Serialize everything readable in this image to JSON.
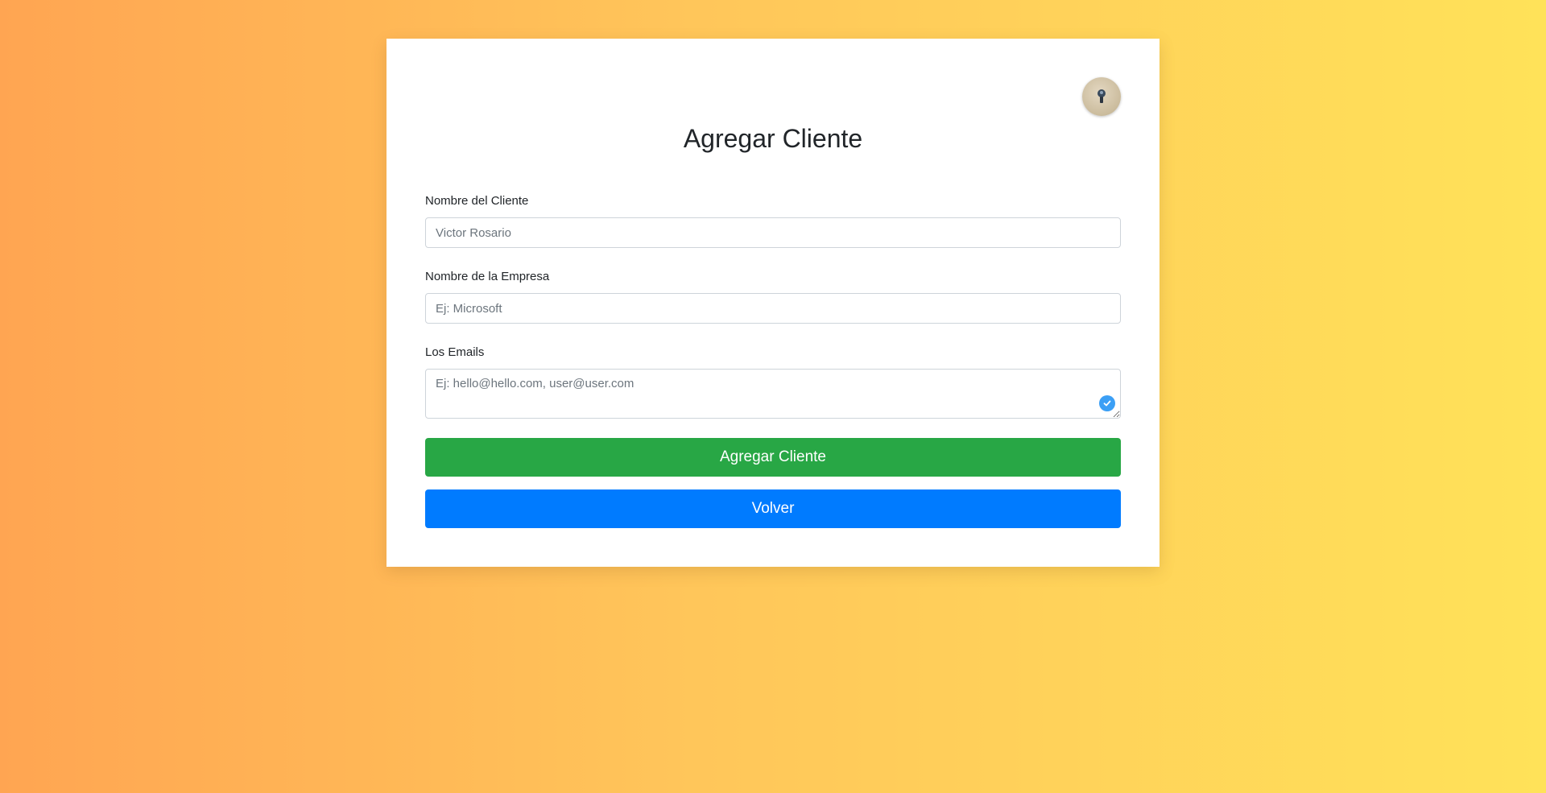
{
  "form": {
    "title": "Agregar Cliente",
    "client_name": {
      "label": "Nombre del Cliente",
      "placeholder": "Victor Rosario"
    },
    "company_name": {
      "label": "Nombre de la Empresa",
      "placeholder": "Ej: Microsoft"
    },
    "emails": {
      "label": "Los Emails",
      "placeholder": "Ej: hello@hello.com, user@user.com"
    },
    "submit_label": "Agregar Cliente",
    "back_label": "Volver"
  },
  "icons": {
    "avatar": "avatar-icon",
    "textarea_badge": "check-circle-icon"
  },
  "colors": {
    "submit": "#28a745",
    "back": "#007bff",
    "badge": "#3b9ff5"
  }
}
